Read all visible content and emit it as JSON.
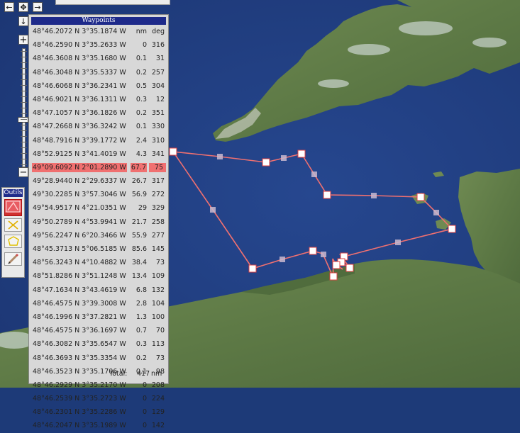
{
  "panel": {
    "title": "Waypoints",
    "header": {
      "coord": "48°46.2072 N 3°35.1874 W",
      "nm": "nm",
      "deg": "deg"
    },
    "rows": [
      {
        "coord": "48°46.2590 N 3°35.2633 W",
        "nm": "0",
        "deg": "316"
      },
      {
        "coord": "48°46.3608 N 3°35.1680 W",
        "nm": "0.1",
        "deg": "31"
      },
      {
        "coord": "48°46.3048 N 3°35.5337 W",
        "nm": "0.2",
        "deg": "257"
      },
      {
        "coord": "48°46.6068 N 3°36.2341 W",
        "nm": "0.5",
        "deg": "304"
      },
      {
        "coord": "48°46.9021 N 3°36.1311 W",
        "nm": "0.3",
        "deg": "12"
      },
      {
        "coord": "48°47.1057 N 3°36.1826 W",
        "nm": "0.2",
        "deg": "351"
      },
      {
        "coord": "48°47.2668 N 3°36.3242 W",
        "nm": "0.1",
        "deg": "330"
      },
      {
        "coord": "48°48.7916 N 3°39.1772 W",
        "nm": "2.4",
        "deg": "310"
      },
      {
        "coord": "48°52.9125 N 3°41.4019 W",
        "nm": "4.3",
        "deg": "341"
      },
      {
        "coord": "49°09.6092 N 2°01.2890 W",
        "nm": "67.7",
        "deg": "75",
        "highlight": true
      },
      {
        "coord": "49°28.9440 N 2°29.6337 W",
        "nm": "26.7",
        "deg": "317"
      },
      {
        "coord": "49°30.2285 N 3°57.3046 W",
        "nm": "56.9",
        "deg": "272"
      },
      {
        "coord": "49°54.9517 N 4°21.0351 W",
        "nm": "29",
        "deg": "329"
      },
      {
        "coord": "49°50.2789 N 4°53.9941 W",
        "nm": "21.7",
        "deg": "258"
      },
      {
        "coord": "49°56.2247 N 6°20.3466 W",
        "nm": "55.9",
        "deg": "277"
      },
      {
        "coord": "48°45.3713 N 5°06.5185 W",
        "nm": "85.6",
        "deg": "145"
      },
      {
        "coord": "48°56.3243 N 4°10.4882 W",
        "nm": "38.4",
        "deg": "73"
      },
      {
        "coord": "48°51.8286 N 3°51.1248 W",
        "nm": "13.4",
        "deg": "109"
      },
      {
        "coord": "48°47.1634 N 3°43.4619 W",
        "nm": "6.8",
        "deg": "132"
      },
      {
        "coord": "48°46.4575 N 3°39.3008 W",
        "nm": "2.8",
        "deg": "104"
      },
      {
        "coord": "48°46.1996 N 3°37.2821 W",
        "nm": "1.3",
        "deg": "100"
      },
      {
        "coord": "48°46.4575 N 3°36.1697 W",
        "nm": "0.7",
        "deg": "70"
      },
      {
        "coord": "48°46.3082 N 3°35.6547 W",
        "nm": "0.3",
        "deg": "113"
      },
      {
        "coord": "48°46.3693 N 3°35.3354 W",
        "nm": "0.2",
        "deg": "73"
      },
      {
        "coord": "48°46.3523 N 3°35.1706 W",
        "nm": "0.1",
        "deg": "98"
      },
      {
        "coord": "48°46.2929 N 3°35.2170 W",
        "nm": "0",
        "deg": "208"
      },
      {
        "coord": "48°46.2539 N 3°35.2723 W",
        "nm": "0",
        "deg": "224"
      },
      {
        "coord": "48°46.2301 N 3°35.2286 W",
        "nm": "0",
        "deg": "129"
      },
      {
        "coord": "48°46.2047 N 3°35.1989 W",
        "nm": "0",
        "deg": "142"
      }
    ],
    "total": {
      "label": "Total:",
      "value": "417",
      "unit": "nm"
    }
  },
  "tools": {
    "title": "Outils",
    "items": [
      "route-tool-icon",
      "cross-tool-icon",
      "polygon-tool-icon",
      "pencil-tool-icon"
    ]
  },
  "nav": [
    "pan-left-icon",
    "pan-center-icon",
    "pan-right-icon",
    "pan-down-icon",
    "zoom-in-icon",
    "zoom-out-icon"
  ],
  "colors": {
    "route": "#f07070",
    "sea": "#24418a",
    "highlight": "#f07070",
    "title_bar": "#1e2a8a"
  }
}
